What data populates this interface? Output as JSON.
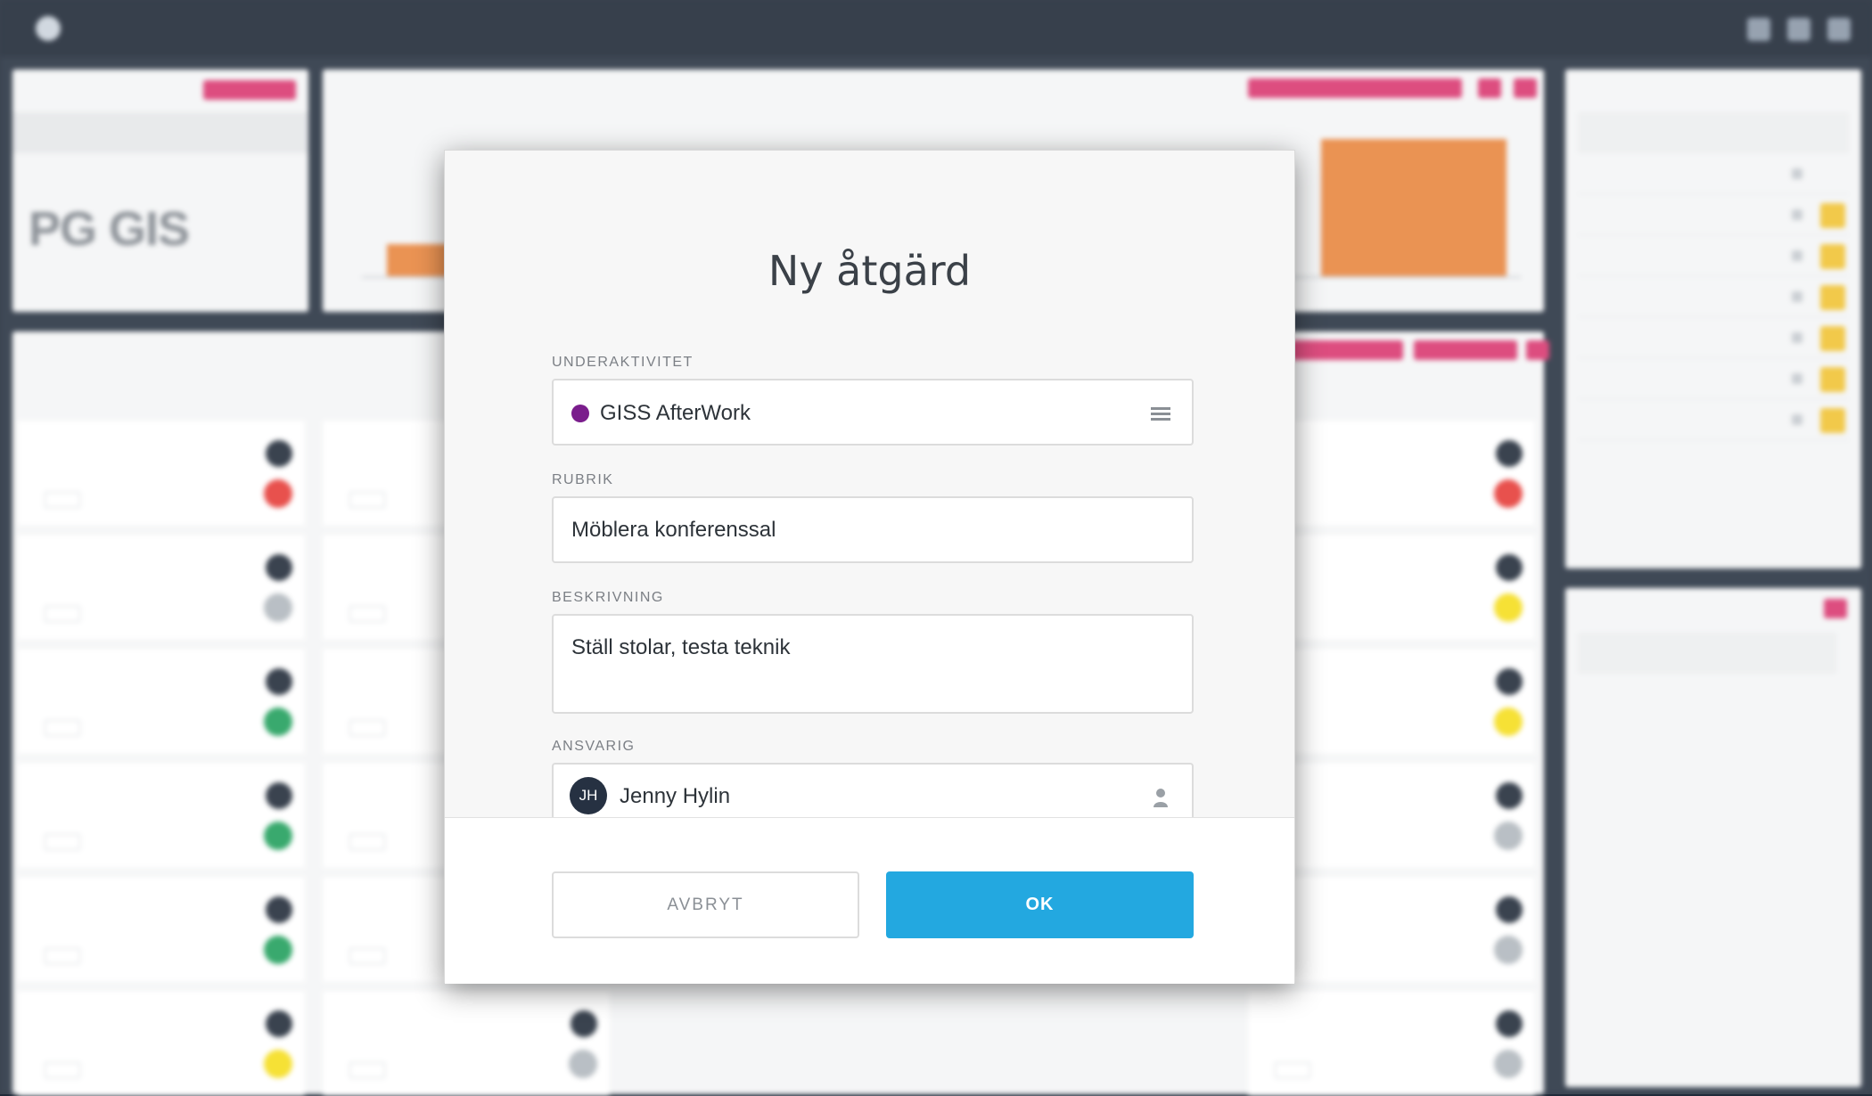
{
  "modal": {
    "title": "Ny åtgärd",
    "underaktivitet": {
      "label": "UNDERAKTIVITET",
      "value": "GISS AfterWork",
      "dot_color": "#7a1d8c"
    },
    "rubrik": {
      "label": "RUBRIK",
      "value": "Möblera konferenssal"
    },
    "beskrivning": {
      "label": "BESKRIVNING",
      "value": "Ställ stolar, testa teknik"
    },
    "ansvarig": {
      "label": "ANSVARIG",
      "initials": "JH",
      "value": "Jenny Hylin"
    },
    "cancel_label": "AVBRYT",
    "ok_label": "OK"
  },
  "background": {
    "katalog_title": "PG GIS",
    "colors": {
      "accent_pink": "#d9356e",
      "accent_blue": "#23a8e0",
      "bar_orange": "#e8843c",
      "status_red": "#e53935",
      "status_green": "#1e9e5a",
      "status_yellow": "#f5dd1a",
      "status_grey": "#b0b7bd"
    }
  }
}
